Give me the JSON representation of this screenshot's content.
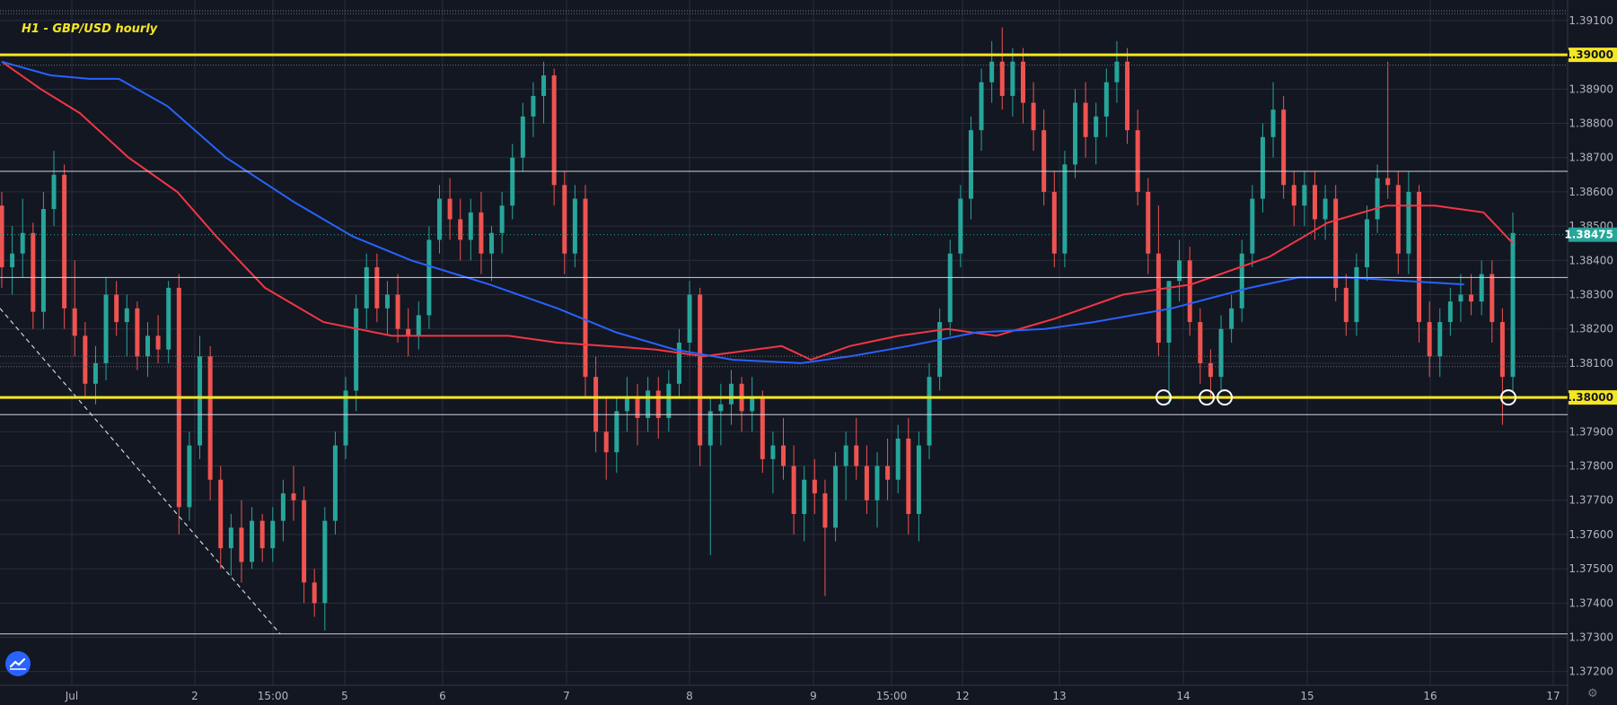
{
  "chart_data": {
    "type": "candlestick",
    "title": "H1 - GBP/USD hourly",
    "x_labels": [
      "Jul",
      "2",
      "15:00",
      "5",
      "6",
      "7",
      "8",
      "9",
      "15:00",
      "12",
      "13",
      "14",
      "15",
      "16",
      "17"
    ],
    "y_ticks": [
      "1.37200",
      "1.37300",
      "1.37400",
      "1.37500",
      "1.37600",
      "1.37700",
      "1.37800",
      "1.37900",
      "1.38000",
      "1.38100",
      "1.38200",
      "1.38300",
      "1.38400",
      "1.38500",
      "1.38600",
      "1.38700",
      "1.38800",
      "1.38900",
      "1.39000",
      "1.39100"
    ],
    "ylim": [
      1.3716,
      1.3916
    ],
    "current_price": "1.38475",
    "resistance_label": "1.39000",
    "support_label": "1.38000",
    "horizontal_lines": [
      {
        "price": 1.39,
        "style": "yellow"
      },
      {
        "price": 1.38,
        "style": "yellow"
      },
      {
        "price": 1.3866,
        "style": "white"
      },
      {
        "price": 1.3835,
        "style": "white"
      },
      {
        "price": 1.3795,
        "style": "white"
      },
      {
        "price": 1.3731,
        "style": "white"
      }
    ],
    "touch_markers": [
      {
        "x_label": "13.85",
        "price": 1.38
      },
      {
        "x_label": "14.2",
        "price": 1.38
      },
      {
        "x_label": "14.35",
        "price": 1.38
      },
      {
        "x_label": "16.65",
        "price": 1.38
      }
    ],
    "candles": [
      [
        1.3856,
        1.386,
        1.3832,
        1.3838
      ],
      [
        1.3838,
        1.385,
        1.383,
        1.3842
      ],
      [
        1.3842,
        1.3858,
        1.3835,
        1.3848
      ],
      [
        1.3848,
        1.3851,
        1.382,
        1.3825
      ],
      [
        1.3825,
        1.386,
        1.382,
        1.3855
      ],
      [
        1.3855,
        1.3872,
        1.385,
        1.3865
      ],
      [
        1.3865,
        1.3868,
        1.382,
        1.3826
      ],
      [
        1.3826,
        1.384,
        1.3812,
        1.3818
      ],
      [
        1.3818,
        1.3822,
        1.38,
        1.3804
      ],
      [
        1.3804,
        1.3815,
        1.3798,
        1.381
      ],
      [
        1.381,
        1.3835,
        1.3805,
        1.383
      ],
      [
        1.383,
        1.3834,
        1.3818,
        1.3822
      ],
      [
        1.3822,
        1.383,
        1.3812,
        1.3826
      ],
      [
        1.3826,
        1.3828,
        1.3808,
        1.3812
      ],
      [
        1.3812,
        1.3822,
        1.3806,
        1.3818
      ],
      [
        1.3818,
        1.3824,
        1.381,
        1.3814
      ],
      [
        1.3814,
        1.3834,
        1.381,
        1.3832
      ],
      [
        1.3832,
        1.3836,
        1.376,
        1.3768
      ],
      [
        1.3768,
        1.379,
        1.3764,
        1.3786
      ],
      [
        1.3786,
        1.3818,
        1.3782,
        1.3812
      ],
      [
        1.3812,
        1.3815,
        1.377,
        1.3776
      ],
      [
        1.3776,
        1.378,
        1.375,
        1.3756
      ],
      [
        1.3756,
        1.3766,
        1.3748,
        1.3762
      ],
      [
        1.3762,
        1.377,
        1.3746,
        1.3752
      ],
      [
        1.3752,
        1.3768,
        1.375,
        1.3764
      ],
      [
        1.3764,
        1.3766,
        1.3752,
        1.3756
      ],
      [
        1.3756,
        1.3768,
        1.3752,
        1.3764
      ],
      [
        1.3764,
        1.3776,
        1.3758,
        1.3772
      ],
      [
        1.3772,
        1.378,
        1.3764,
        1.377
      ],
      [
        1.377,
        1.3774,
        1.374,
        1.3746
      ],
      [
        1.3746,
        1.375,
        1.3736,
        1.374
      ],
      [
        1.374,
        1.3768,
        1.3732,
        1.3764
      ],
      [
        1.3764,
        1.379,
        1.376,
        1.3786
      ],
      [
        1.3786,
        1.3806,
        1.3782,
        1.3802
      ],
      [
        1.3802,
        1.383,
        1.3796,
        1.3826
      ],
      [
        1.3826,
        1.3842,
        1.382,
        1.3838
      ],
      [
        1.3838,
        1.3842,
        1.3822,
        1.3826
      ],
      [
        1.3826,
        1.3834,
        1.3818,
        1.383
      ],
      [
        1.383,
        1.3836,
        1.3816,
        1.382
      ],
      [
        1.382,
        1.3826,
        1.3812,
        1.3818
      ],
      [
        1.3818,
        1.3828,
        1.3814,
        1.3824
      ],
      [
        1.3824,
        1.385,
        1.382,
        1.3846
      ],
      [
        1.3846,
        1.3862,
        1.3842,
        1.3858
      ],
      [
        1.3858,
        1.3864,
        1.3846,
        1.3852
      ],
      [
        1.3852,
        1.3858,
        1.384,
        1.3846
      ],
      [
        1.3846,
        1.3858,
        1.384,
        1.3854
      ],
      [
        1.3854,
        1.386,
        1.3836,
        1.3842
      ],
      [
        1.3842,
        1.385,
        1.3834,
        1.3848
      ],
      [
        1.3848,
        1.386,
        1.3842,
        1.3856
      ],
      [
        1.3856,
        1.3874,
        1.3852,
        1.387
      ],
      [
        1.387,
        1.3886,
        1.3866,
        1.3882
      ],
      [
        1.3882,
        1.3892,
        1.3876,
        1.3888
      ],
      [
        1.3888,
        1.3898,
        1.388,
        1.3894
      ],
      [
        1.3894,
        1.3896,
        1.3856,
        1.3862
      ],
      [
        1.3862,
        1.3866,
        1.3836,
        1.3842
      ],
      [
        1.3842,
        1.3862,
        1.3838,
        1.3858
      ],
      [
        1.3858,
        1.3862,
        1.38,
        1.3806
      ],
      [
        1.3806,
        1.3812,
        1.3784,
        1.379
      ],
      [
        1.379,
        1.38,
        1.3776,
        1.3784
      ],
      [
        1.3784,
        1.38,
        1.3778,
        1.3796
      ],
      [
        1.3796,
        1.3806,
        1.379,
        1.38
      ],
      [
        1.38,
        1.3804,
        1.3786,
        1.3794
      ],
      [
        1.3794,
        1.3806,
        1.379,
        1.3802
      ],
      [
        1.3802,
        1.3806,
        1.3788,
        1.3794
      ],
      [
        1.3794,
        1.3808,
        1.379,
        1.3804
      ],
      [
        1.3804,
        1.382,
        1.38,
        1.3816
      ],
      [
        1.3816,
        1.3834,
        1.3812,
        1.383
      ],
      [
        1.383,
        1.3832,
        1.378,
        1.3786
      ],
      [
        1.3786,
        1.38,
        1.3754,
        1.3796
      ],
      [
        1.3796,
        1.3804,
        1.3786,
        1.3798
      ],
      [
        1.3798,
        1.3808,
        1.3792,
        1.3804
      ],
      [
        1.3804,
        1.3806,
        1.379,
        1.3796
      ],
      [
        1.3796,
        1.3806,
        1.379,
        1.38
      ],
      [
        1.38,
        1.3802,
        1.3778,
        1.3782
      ],
      [
        1.3782,
        1.379,
        1.3772,
        1.3786
      ],
      [
        1.3786,
        1.3794,
        1.3776,
        1.378
      ],
      [
        1.378,
        1.3786,
        1.376,
        1.3766
      ],
      [
        1.3766,
        1.378,
        1.3758,
        1.3776
      ],
      [
        1.3776,
        1.3782,
        1.3766,
        1.3772
      ],
      [
        1.3772,
        1.3776,
        1.3742,
        1.3762
      ],
      [
        1.3762,
        1.3784,
        1.3758,
        1.378
      ],
      [
        1.378,
        1.379,
        1.377,
        1.3786
      ],
      [
        1.3786,
        1.3794,
        1.3776,
        1.378
      ],
      [
        1.378,
        1.3786,
        1.3766,
        1.377
      ],
      [
        1.377,
        1.3784,
        1.3762,
        1.378
      ],
      [
        1.378,
        1.3788,
        1.377,
        1.3776
      ],
      [
        1.3776,
        1.3792,
        1.3772,
        1.3788
      ],
      [
        1.3788,
        1.3794,
        1.376,
        1.3766
      ],
      [
        1.3766,
        1.379,
        1.3758,
        1.3786
      ],
      [
        1.3786,
        1.381,
        1.3782,
        1.3806
      ],
      [
        1.3806,
        1.3826,
        1.3802,
        1.3822
      ],
      [
        1.3822,
        1.3846,
        1.3818,
        1.3842
      ],
      [
        1.3842,
        1.3862,
        1.3838,
        1.3858
      ],
      [
        1.3858,
        1.3882,
        1.3852,
        1.3878
      ],
      [
        1.3878,
        1.3896,
        1.3872,
        1.3892
      ],
      [
        1.3892,
        1.3904,
        1.3886,
        1.3898
      ],
      [
        1.3898,
        1.3908,
        1.3884,
        1.3888
      ],
      [
        1.3888,
        1.3902,
        1.3882,
        1.3898
      ],
      [
        1.3898,
        1.3902,
        1.388,
        1.3886
      ],
      [
        1.3886,
        1.3892,
        1.3872,
        1.3878
      ],
      [
        1.3878,
        1.3884,
        1.3856,
        1.386
      ],
      [
        1.386,
        1.3866,
        1.3838,
        1.3842
      ],
      [
        1.3842,
        1.3872,
        1.3838,
        1.3868
      ],
      [
        1.3868,
        1.389,
        1.3864,
        1.3886
      ],
      [
        1.3886,
        1.3892,
        1.387,
        1.3876
      ],
      [
        1.3876,
        1.3886,
        1.3868,
        1.3882
      ],
      [
        1.3882,
        1.3896,
        1.3876,
        1.3892
      ],
      [
        1.3892,
        1.3904,
        1.3886,
        1.3898
      ],
      [
        1.3898,
        1.3902,
        1.3874,
        1.3878
      ],
      [
        1.3878,
        1.3884,
        1.3856,
        1.386
      ],
      [
        1.386,
        1.3864,
        1.3836,
        1.3842
      ],
      [
        1.3842,
        1.3856,
        1.3812,
        1.3816
      ],
      [
        1.3816,
        1.3822,
        1.3798,
        1.3834
      ],
      [
        1.3834,
        1.3846,
        1.3828,
        1.384
      ],
      [
        1.384,
        1.3844,
        1.3818,
        1.3822
      ],
      [
        1.3822,
        1.3826,
        1.3804,
        1.381
      ],
      [
        1.381,
        1.3814,
        1.38,
        1.3806
      ],
      [
        1.3806,
        1.3824,
        1.3802,
        1.382
      ],
      [
        1.382,
        1.383,
        1.3816,
        1.3826
      ],
      [
        1.3826,
        1.3846,
        1.3822,
        1.3842
      ],
      [
        1.3842,
        1.3862,
        1.3838,
        1.3858
      ],
      [
        1.3858,
        1.388,
        1.3854,
        1.3876
      ],
      [
        1.3876,
        1.3892,
        1.387,
        1.3884
      ],
      [
        1.3884,
        1.3888,
        1.3858,
        1.3862
      ],
      [
        1.3862,
        1.3866,
        1.385,
        1.3856
      ],
      [
        1.3856,
        1.3866,
        1.385,
        1.3862
      ],
      [
        1.3862,
        1.3866,
        1.3846,
        1.3852
      ],
      [
        1.3852,
        1.3862,
        1.3846,
        1.3858
      ],
      [
        1.3858,
        1.3862,
        1.3828,
        1.3832
      ],
      [
        1.3832,
        1.3836,
        1.3818,
        1.3822
      ],
      [
        1.3822,
        1.3842,
        1.3818,
        1.3838
      ],
      [
        1.3838,
        1.3856,
        1.3834,
        1.3852
      ],
      [
        1.3852,
        1.3868,
        1.3848,
        1.3864
      ],
      [
        1.3864,
        1.3898,
        1.3858,
        1.3862
      ],
      [
        1.3862,
        1.3866,
        1.3836,
        1.3842
      ],
      [
        1.3842,
        1.3866,
        1.3836,
        1.386
      ],
      [
        1.386,
        1.3862,
        1.3816,
        1.3822
      ],
      [
        1.3822,
        1.3828,
        1.3806,
        1.3812
      ],
      [
        1.3812,
        1.3826,
        1.3806,
        1.3822
      ],
      [
        1.3822,
        1.3832,
        1.3818,
        1.3828
      ],
      [
        1.3828,
        1.3836,
        1.3822,
        1.383
      ],
      [
        1.383,
        1.3836,
        1.3824,
        1.3828
      ],
      [
        1.3828,
        1.384,
        1.3824,
        1.3836
      ],
      [
        1.3836,
        1.384,
        1.3816,
        1.3822
      ],
      [
        1.3822,
        1.3826,
        1.3792,
        1.3806
      ],
      [
        1.3806,
        1.3854,
        1.3802,
        1.3848
      ]
    ],
    "series": [
      {
        "name": "",
        "color": "#f23645",
        "points": [
          [
            0,
            1.3898
          ],
          [
            0.04,
            1.389
          ],
          [
            0.08,
            1.3883
          ],
          [
            0.13,
            1.387
          ],
          [
            0.18,
            1.386
          ],
          [
            0.22,
            1.3847
          ],
          [
            0.27,
            1.3832
          ],
          [
            0.33,
            1.3822
          ],
          [
            0.4,
            1.3818
          ],
          [
            0.45,
            1.3818
          ],
          [
            0.52,
            1.3818
          ],
          [
            0.57,
            1.3816
          ],
          [
            0.62,
            1.3815
          ],
          [
            0.67,
            1.3814
          ],
          [
            0.72,
            1.3812
          ],
          [
            0.8,
            1.3815
          ],
          [
            0.83,
            1.3811
          ],
          [
            0.87,
            1.3815
          ],
          [
            0.92,
            1.3818
          ],
          [
            0.97,
            1.382
          ],
          [
            1.02,
            1.3818
          ],
          [
            1.08,
            1.3823
          ],
          [
            1.15,
            1.383
          ],
          [
            1.22,
            1.3833
          ],
          [
            1.3,
            1.3841
          ],
          [
            1.36,
            1.3851
          ],
          [
            1.42,
            1.3856
          ],
          [
            1.47,
            1.3856
          ],
          [
            1.52,
            1.3854
          ],
          [
            1.55,
            1.3845
          ]
        ]
      },
      {
        "name": "",
        "color": "#2962ff",
        "points": [
          [
            0,
            1.3898
          ],
          [
            0.05,
            1.3894
          ],
          [
            0.09,
            1.3893
          ],
          [
            0.12,
            1.3893
          ],
          [
            0.17,
            1.3885
          ],
          [
            0.23,
            1.387
          ],
          [
            0.3,
            1.3857
          ],
          [
            0.36,
            1.3847
          ],
          [
            0.42,
            1.384
          ],
          [
            0.5,
            1.3833
          ],
          [
            0.57,
            1.3826
          ],
          [
            0.63,
            1.3819
          ],
          [
            0.69,
            1.3814
          ],
          [
            0.75,
            1.3811
          ],
          [
            0.82,
            1.381
          ],
          [
            0.87,
            1.3812
          ],
          [
            0.93,
            1.3815
          ],
          [
            1.0,
            1.3819
          ],
          [
            1.07,
            1.382
          ],
          [
            1.12,
            1.3822
          ],
          [
            1.2,
            1.3826
          ],
          [
            1.28,
            1.3832
          ],
          [
            1.33,
            1.3835
          ],
          [
            1.38,
            1.3835
          ],
          [
            1.44,
            1.3834
          ],
          [
            1.5,
            1.3833
          ]
        ]
      }
    ]
  }
}
